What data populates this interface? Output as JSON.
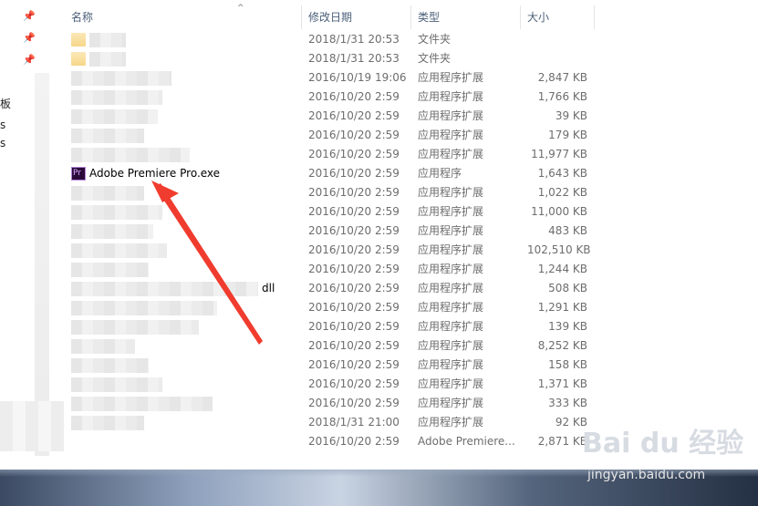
{
  "header": {
    "col_name": "名称",
    "col_date": "修改日期",
    "col_type": "类型",
    "col_size": "大小"
  },
  "nav": {
    "edge_text_1": "板",
    "edge_text_2": "s",
    "edge_text_3": "s"
  },
  "rows": [
    {
      "name": "",
      "date": "2018/1/31 20:53",
      "type": "文件夹",
      "size": "",
      "icon": "folder-icon"
    },
    {
      "name": "",
      "date": "2018/1/31 20:53",
      "type": "文件夹",
      "size": "",
      "icon": "folder-icon"
    },
    {
      "name": "",
      "date": "2016/10/19 19:06",
      "type": "应用程序扩展",
      "size": "2,847 KB"
    },
    {
      "name": "",
      "date": "2016/10/20 2:59",
      "type": "应用程序扩展",
      "size": "1,766 KB"
    },
    {
      "name": "",
      "date": "2016/10/20 2:59",
      "type": "应用程序扩展",
      "size": "39 KB"
    },
    {
      "name": "",
      "date": "2016/10/20 2:59",
      "type": "应用程序扩展",
      "size": "179 KB"
    },
    {
      "name": "",
      "date": "2016/10/20 2:59",
      "type": "应用程序扩展",
      "size": "11,977 KB"
    },
    {
      "name": "Adobe Premiere Pro.exe",
      "date": "2016/10/20 2:59",
      "type": "应用程序",
      "size": "1,643 KB",
      "icon": "premiere-pro-icon",
      "icon_label": "Pr"
    },
    {
      "name": "",
      "date": "2016/10/20 2:59",
      "type": "应用程序扩展",
      "size": "1,022 KB"
    },
    {
      "name": "",
      "date": "2016/10/20 2:59",
      "type": "应用程序扩展",
      "size": "11,000 KB"
    },
    {
      "name": "",
      "date": "2016/10/20 2:59",
      "type": "应用程序扩展",
      "size": "483 KB"
    },
    {
      "name": "",
      "date": "2016/10/20 2:59",
      "type": "应用程序扩展",
      "size": "102,510 KB"
    },
    {
      "name": "",
      "date": "2016/10/20 2:59",
      "type": "应用程序扩展",
      "size": "1,244 KB"
    },
    {
      "name": "dll",
      "date": "2016/10/20 2:59",
      "type": "应用程序扩展",
      "size": "508 KB"
    },
    {
      "name": "",
      "date": "2016/10/20 2:59",
      "type": "应用程序扩展",
      "size": "1,291 KB"
    },
    {
      "name": "",
      "date": "2016/10/20 2:59",
      "type": "应用程序扩展",
      "size": "139 KB"
    },
    {
      "name": "",
      "date": "2016/10/20 2:59",
      "type": "应用程序扩展",
      "size": "8,252 KB"
    },
    {
      "name": "",
      "date": "2016/10/20 2:59",
      "type": "应用程序扩展",
      "size": "158 KB"
    },
    {
      "name": "",
      "date": "2016/10/20 2:59",
      "type": "应用程序扩展",
      "size": "1,371 KB"
    },
    {
      "name": "",
      "date": "2016/10/20 2:59",
      "type": "应用程序扩展",
      "size": "333 KB"
    },
    {
      "name": "",
      "date": "2018/1/31 21:00",
      "type": "应用程序扩展",
      "size": "92 KB"
    },
    {
      "name": "",
      "date": "2016/10/20 2:59",
      "type": "Adobe Premiere...",
      "size": "2,871 KB"
    }
  ],
  "watermark": {
    "main": "Bai du 经验",
    "sub": "jingyan.baidu.com"
  },
  "colors": {
    "arrow": "#f03c2e",
    "header_text": "#4c607a"
  }
}
